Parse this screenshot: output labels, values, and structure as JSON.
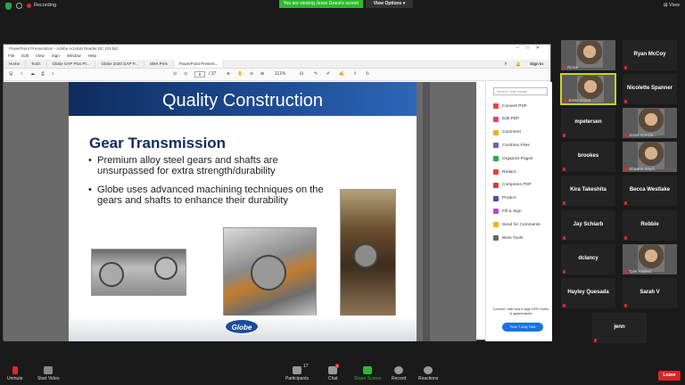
{
  "topbar": {
    "recording": "Recording",
    "viewing_banner": "You are viewing Jesse Grace's screen",
    "view_options": "View Options",
    "view": "View"
  },
  "acrobat": {
    "title": "PowerPoint Presentation - Adobe Acrobat Reader DC (32-bit)",
    "menu": [
      "File",
      "Edit",
      "View",
      "Sign",
      "Window",
      "Help"
    ],
    "tabs": [
      "Home",
      "Tools",
      "Globe GAP Plus Pr...",
      "Globe 2020 GAP P...",
      "SMA Pres",
      "PowerPoint Present..."
    ],
    "help_icon": "?",
    "sign_in": "Sign In",
    "page_current": "8",
    "page_total": "/ 37",
    "zoom": "111%",
    "search_placeholder": "Search 'Edit Image'",
    "tools": [
      {
        "label": "Convert PDF",
        "color": "#e14b3b"
      },
      {
        "label": "Edit PDF",
        "color": "#d6467e"
      },
      {
        "label": "Comment",
        "color": "#f2b200"
      },
      {
        "label": "Combine Files",
        "color": "#6e5cc4"
      },
      {
        "label": "Organize Pages",
        "color": "#29a84f"
      },
      {
        "label": "Redact",
        "color": "#e0443a"
      },
      {
        "label": "Compress PDF",
        "color": "#d23c3c"
      },
      {
        "label": "Protect",
        "color": "#4b4fb8"
      },
      {
        "label": "Fill & Sign",
        "color": "#b84ac4"
      },
      {
        "label": "Send for Comments",
        "color": "#f2b200"
      },
      {
        "label": "More Tools",
        "color": "#666666"
      }
    ],
    "promo": "Convert, edit and e-sign PDF forms & agreements",
    "trial": "Free 7-Day Trial"
  },
  "slide": {
    "title": "Quality Construction",
    "subtitle": "Gear Transmission",
    "bullet_symbol": "•",
    "bullets": [
      "Premium alloy steel gears and shafts are unsurpassed for extra strength/durability",
      "Globe uses advanced machining techniques on the gears and shafts to enhance their durability"
    ],
    "logo": "Globe"
  },
  "participants": [
    {
      "name": "Rickie",
      "video": true
    },
    {
      "name": "Ryan McCoy",
      "video": false
    },
    {
      "name": "Jesse Grace",
      "video": true,
      "active": true
    },
    {
      "name": "Nicolette Spanner",
      "video": false
    },
    {
      "name": "mpetersen",
      "video": false
    },
    {
      "name": "Jesse Gonzal...",
      "video": true
    },
    {
      "name": "brookes",
      "video": false
    },
    {
      "name": "Shawna Snyd...",
      "video": true
    },
    {
      "name": "Kira Takeshita",
      "video": false
    },
    {
      "name": "Becca Westlake",
      "video": false
    },
    {
      "name": "Jay Schiarb",
      "video": false
    },
    {
      "name": "Robbie",
      "video": false
    },
    {
      "name": "dclancy",
      "video": false
    },
    {
      "name": "Tyler Alvarez",
      "video": true
    },
    {
      "name": "Hayley Quesada",
      "video": false
    },
    {
      "name": "Sarah V",
      "video": false
    },
    {
      "name": "jenn",
      "video": false
    }
  ],
  "bottombar": {
    "unmute": "Unmute",
    "start_video": "Start Video",
    "participants": "Participants",
    "participants_count": "17",
    "chat": "Chat",
    "chat_badge": "5",
    "share_screen": "Share Screen",
    "record": "Record",
    "reactions": "Reactions",
    "leave": "Leave"
  }
}
